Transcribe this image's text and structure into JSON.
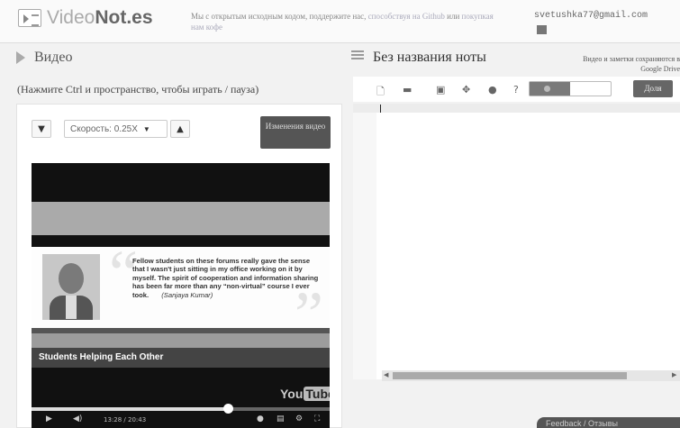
{
  "header": {
    "logo_video": "Video",
    "logo_notes": "Not.es",
    "support_text": "Мы с открытым исходным кодом, поддержите нас,",
    "support_link_github": "способствуя на Github",
    "support_or": "или",
    "support_link_coffee": "покупкая нам кофе",
    "account_email": "svetushka77@gmail.com"
  },
  "video_panel": {
    "title": "Видео",
    "hint": "(Нажмите Ctrl и пространство, чтобы играть / пауза)",
    "speed_label": "Скорость: 0.25X",
    "change_video_label": "Изменения видео",
    "down_icon": "chevron-down",
    "up_icon": "chevron-up"
  },
  "player": {
    "quote": "Fellow students on these forums really gave the sense that I wasn't just sitting in my office working on it by myself. The spirit of cooperation and information sharing has been far more than any “non-virtual” course I ever took.",
    "quote_author": "(Sanjaya Kumar)",
    "banner": "Students Helping Each Other",
    "brand_you": "You",
    "brand_tube": "Tube",
    "time_current": "13:28",
    "time_total": "20:43",
    "progress": 0.66
  },
  "notes_panel": {
    "title": "Без названия ноты",
    "saved_notice_line1": "Видео и заметки сохраняются в",
    "saved_notice_line2": "Google Drive",
    "share_label": "Доля",
    "toolbar_icons": [
      "new-file-icon",
      "open-folder-icon",
      "save-icon",
      "crosshair-icon",
      "record-icon",
      "help-icon"
    ]
  },
  "bottom_pill": {
    "label": "Feedback / Отзывы"
  },
  "colors": {
    "header_bg": "#fafafa",
    "page_bg": "#f2f2f2",
    "button_dark": "#555555"
  }
}
